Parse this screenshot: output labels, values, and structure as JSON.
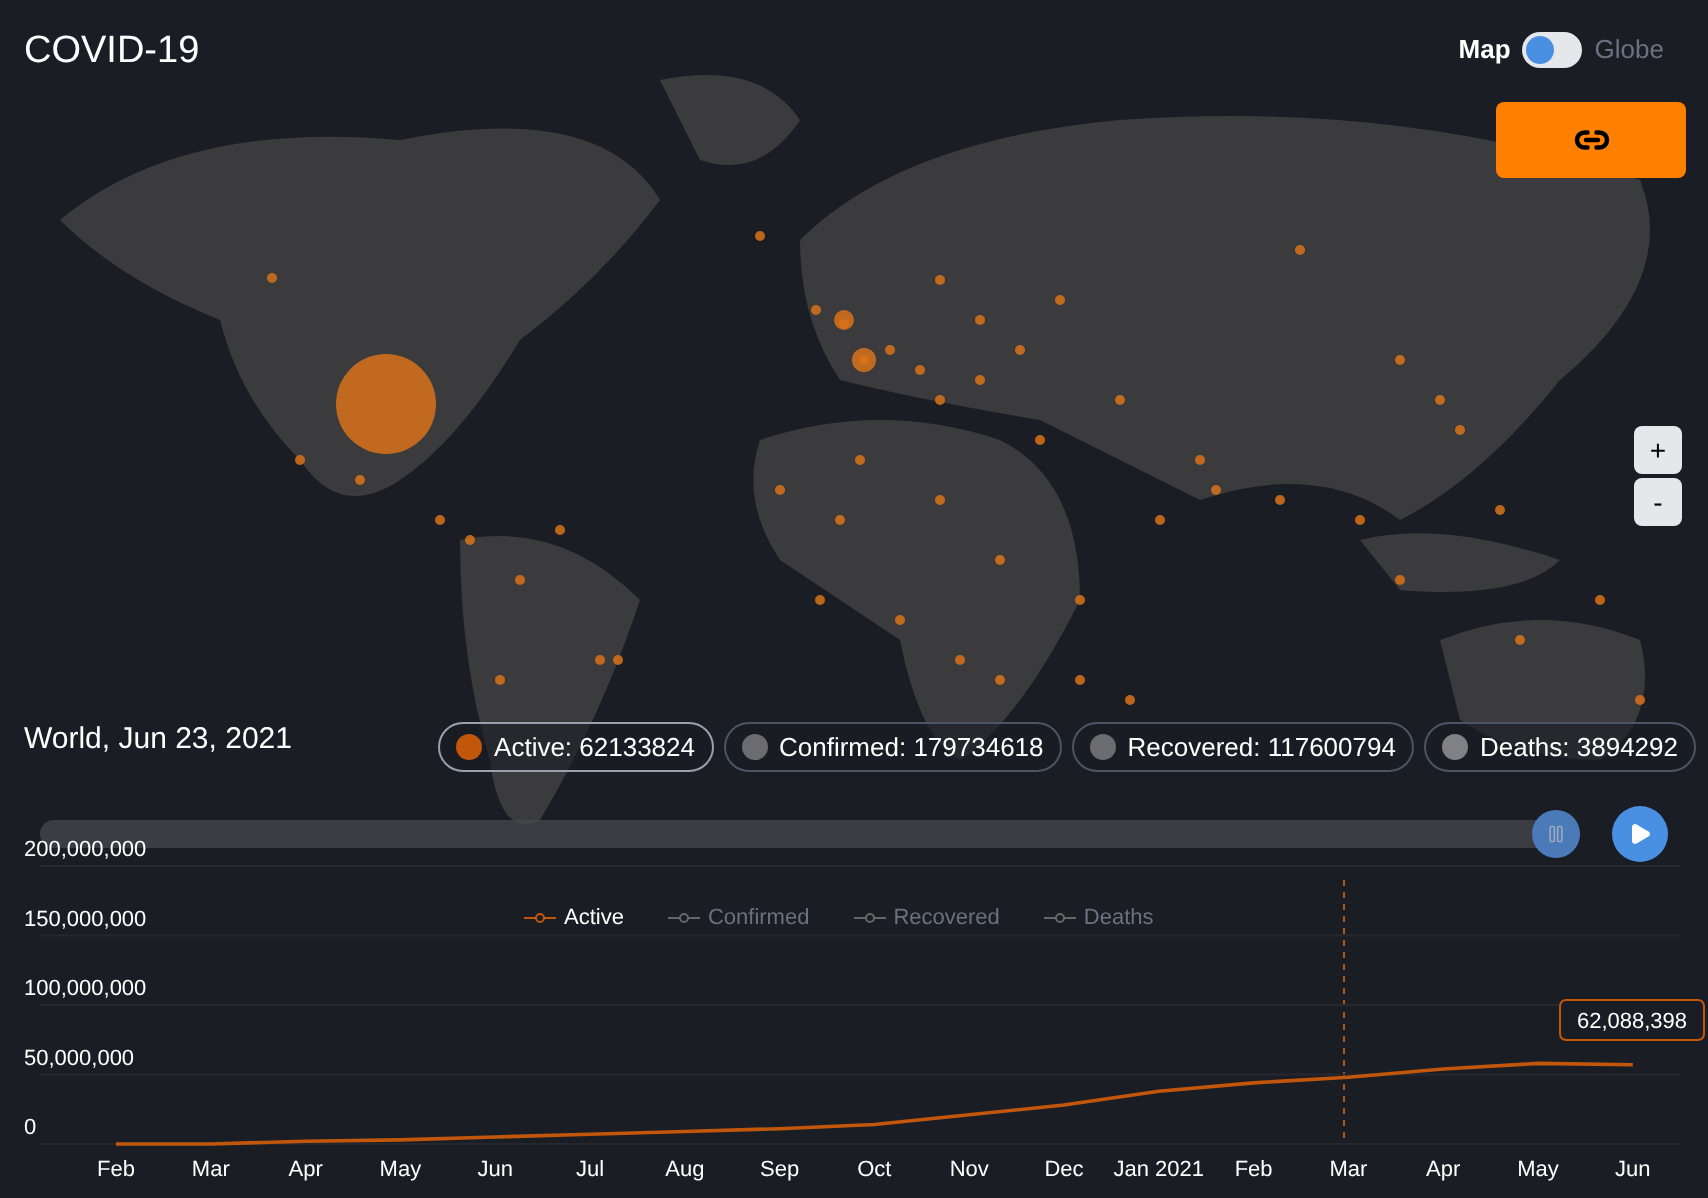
{
  "header": {
    "title": "COVID-19"
  },
  "view_toggle": {
    "map_label": "Map",
    "globe_label": "Globe",
    "globe_on": false
  },
  "zoom_buttons": [
    "+",
    "-"
  ],
  "date_label": "World, Jun 23, 2021",
  "stats": [
    {
      "label": "Active: 62133824",
      "color": "#c2570c",
      "selected": true
    },
    {
      "label": "Confirmed: 179734618",
      "color": "#6b6b70",
      "selected": false
    },
    {
      "label": "Recovered: 117600794",
      "color": "#6b6b70",
      "selected": false
    },
    {
      "label": "Deaths: 3894292",
      "color": "#808085",
      "selected": false
    }
  ],
  "timeline": {
    "level": 1,
    "playing": false
  },
  "legend": [
    {
      "selected": true
    },
    {
      "label": "Confirmed",
      "selected": false
    },
    {
      "label": "Recovered",
      "selected": false
    },
    {
      "label": "Deaths",
      "selected": false
    }
  ],
  "chart": {
    "tooltip": "62,088,398",
    "chart_data": {
      "type": "line",
      "categories": [
        "Feb",
        "Mar",
        "Apr",
        "May",
        "Jun",
        "Jul",
        "Aug",
        "Sep",
        "Oct",
        "Nov",
        "Dec",
        "Jan 2021",
        "Feb",
        "Mar",
        "Apr",
        "May",
        "Jun"
      ],
      "series": [
        {
          "name": "Active",
          "color": "#c2570c",
          "values": [
            0,
            0,
            2000000,
            3000000,
            5000000,
            7000000,
            9000000,
            11000000,
            14000000,
            21000000,
            28000000,
            38000000,
            44000000,
            48000000,
            54000000,
            58000000,
            57000000
          ]
        }
      ],
      "ylim": [
        0,
        200000000
      ],
      "grid": true,
      "yticks": [
        {
          "value": 0,
          "label": "0"
        },
        {
          "value": 50000000,
          "label": "50,000,000"
        },
        {
          "value": 100000000,
          "label": "100,000,000"
        },
        {
          "value": 150000000,
          "label": "150,000,000"
        },
        {
          "value": 200000000,
          "label": "200,000,000"
        }
      ]
    }
  }
}
